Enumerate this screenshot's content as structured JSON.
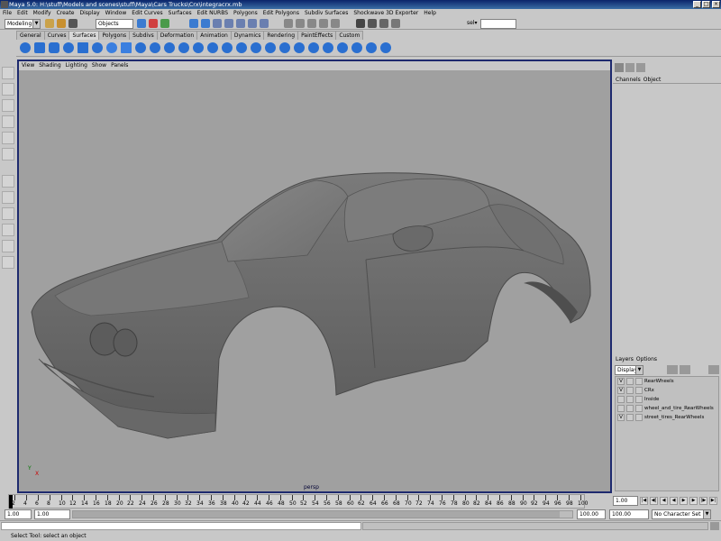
{
  "window": {
    "title": "Maya 5.0: H:\\stuff\\Models and scenes\\stuff\\Maya\\Cars Trucks\\Crx\\integracrx.mb"
  },
  "menubar": [
    "File",
    "Edit",
    "Modify",
    "Create",
    "Display",
    "Window",
    "Edit Curves",
    "Surfaces",
    "Edit NURBS",
    "Polygons",
    "Edit Polygons",
    "Subdiv Surfaces",
    "Shockwave 3D Exporter",
    "Help"
  ],
  "statusline": {
    "mode": "Modeling",
    "select": "Objects",
    "sel_label": "sel▾"
  },
  "shelf_tabs": [
    "General",
    "Curves",
    "Surfaces",
    "Polygons",
    "Subdivs",
    "Deformation",
    "Animation",
    "Dynamics",
    "Rendering",
    "PaintEffects",
    "Custom"
  ],
  "active_shelf": "Surfaces",
  "panel_menu": [
    "View",
    "Shading",
    "Lighting",
    "Show",
    "Panels"
  ],
  "viewport": {
    "camera": "persp",
    "axis_x": "X",
    "axis_y": "Y"
  },
  "channel_box": {
    "tabs": [
      "Channels",
      "Object"
    ]
  },
  "layers": {
    "menu": [
      "Layers",
      "Options"
    ],
    "display": "Display",
    "rows": [
      {
        "vis": "V",
        "name": "RearWheels"
      },
      {
        "vis": "V",
        "name": "CRx"
      },
      {
        "vis": "",
        "name": "Inside"
      },
      {
        "vis": "",
        "name": "wheel_and_tire_RearWheels"
      },
      {
        "vis": "V",
        "name": "street_tires_RearWheels"
      }
    ]
  },
  "timeslider": {
    "labels": [
      "2",
      "4",
      "6",
      "8",
      "10",
      "12",
      "14",
      "16",
      "18",
      "20",
      "22",
      "24",
      "26",
      "28",
      "30",
      "32",
      "34",
      "36",
      "38",
      "40",
      "42",
      "44",
      "46",
      "48",
      "50",
      "52",
      "54",
      "56",
      "58",
      "60",
      "62",
      "64",
      "66",
      "68",
      "70",
      "72",
      "74",
      "76",
      "78",
      "80",
      "82",
      "84",
      "86",
      "88",
      "90",
      "92",
      "94",
      "96",
      "98",
      "100"
    ],
    "current_frame": "1.00"
  },
  "rangeslider": {
    "start": "1.00",
    "playback_start": "1.00",
    "playback_end": "100.00",
    "end": "100.00",
    "char_set": "No Character Set"
  },
  "helpline": "Select Tool: select an object",
  "colors": {
    "viewport_bg": "#a0a0a0",
    "frame_active": "#1e2a6e",
    "car": "#6a6a6a"
  }
}
